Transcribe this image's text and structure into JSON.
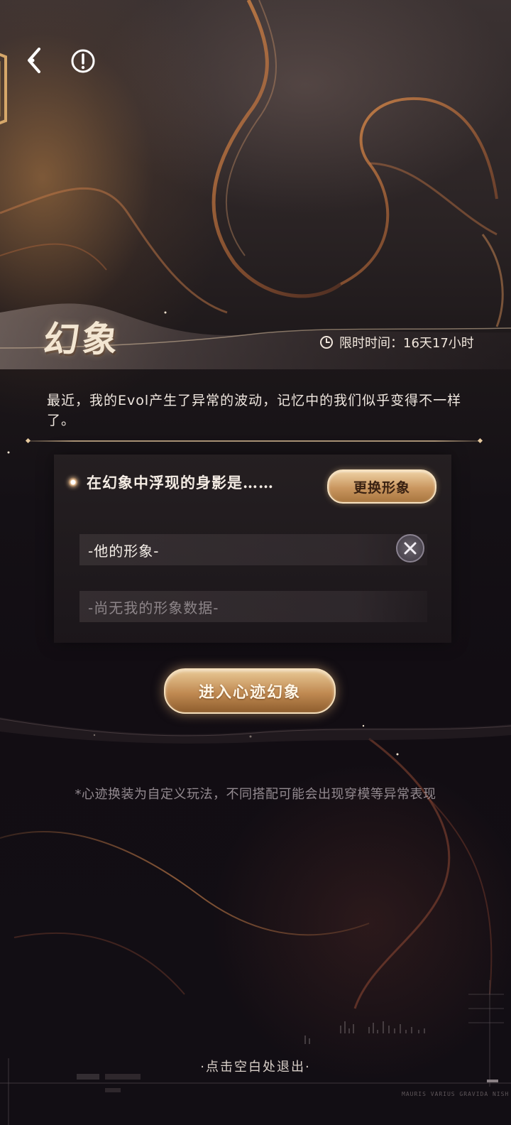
{
  "title": "幻象",
  "timer": {
    "icon": "clock-icon",
    "label": "限时时间：16天17小时"
  },
  "description": "最近，我的Evol产生了异常的波动，记忆中的我们似乎变得不一样了。",
  "panel": {
    "question": "在幻象中浮现的身影是……",
    "change_button": "更换形象",
    "his_appearance": "-他的形象-",
    "my_appearance": "-尚无我的形象数据-"
  },
  "enter_button": "进入心迹幻象",
  "notice": "*心迹换装为自定义玩法，不同搭配可能会出现穿模等异常表现",
  "exit_hint": "·点击空白处退出·",
  "deco_caption": "MAURIS VARIUS GRAVIDA NISH",
  "colors": {
    "accent_gold": "#c9965f",
    "text_light": "#efe7df",
    "text_muted": "#938a90"
  }
}
